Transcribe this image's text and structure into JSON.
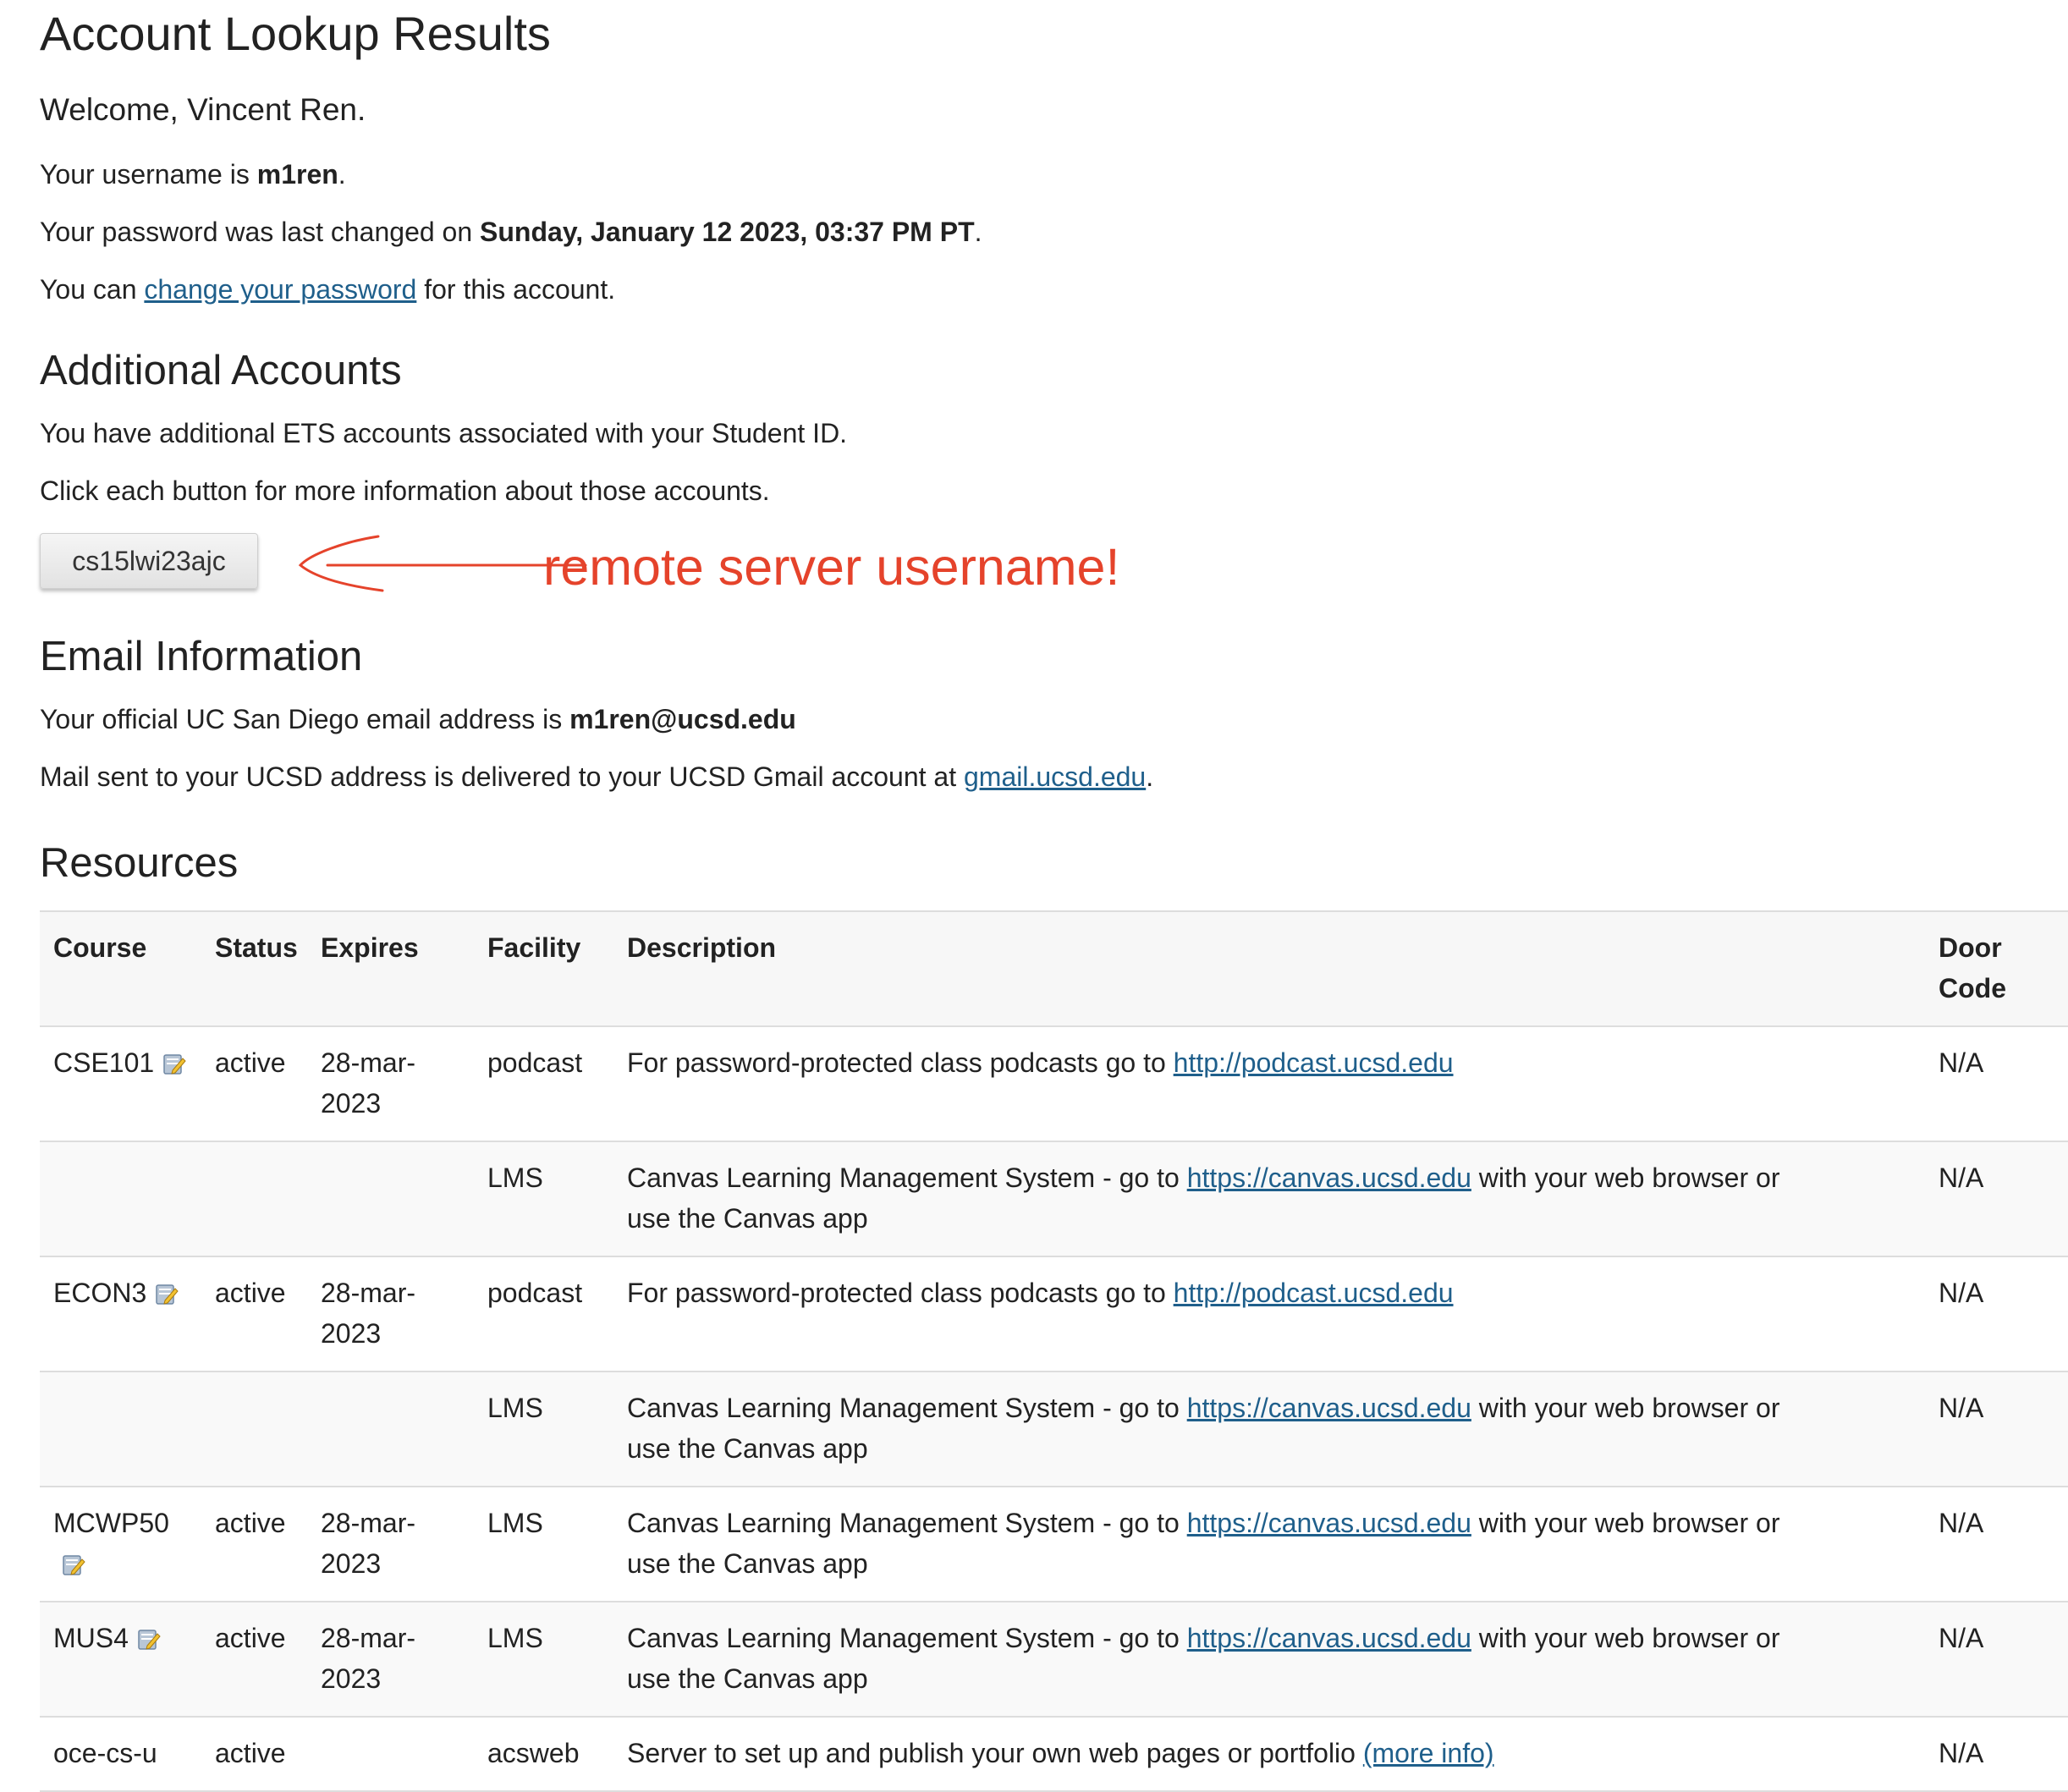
{
  "header": {
    "title": "Account Lookup Results"
  },
  "welcome": "Welcome, Vincent Ren.",
  "username_line": {
    "prefix": "Your username is ",
    "value": "m1ren",
    "suffix": "."
  },
  "password_line": {
    "prefix": "Your password was last changed on ",
    "value": "Sunday, January 12 2023, 03:37 PM PT",
    "suffix": "."
  },
  "change_line": {
    "prefix": "You can ",
    "link": "change your password",
    "suffix": " for this account."
  },
  "additional": {
    "title": "Additional Accounts",
    "line1": "You have additional ETS accounts associated with your Student ID.",
    "line2": "Click each button for more information about those accounts.",
    "button_label": "cs15lwi23ajc",
    "annotation": "remote server username!"
  },
  "email": {
    "title": "Email Information",
    "line1_prefix": "Your official UC San Diego email address is ",
    "line1_value": "m1ren@ucsd.edu",
    "line2_prefix": "Mail sent to your UCSD address is delivered to your UCSD Gmail account at ",
    "line2_link": "gmail.ucsd.edu",
    "line2_suffix": "."
  },
  "resources": {
    "title": "Resources",
    "headers": {
      "course": "Course",
      "status": "Status",
      "expires": "Expires",
      "facility": "Facility",
      "description": "Description",
      "door_line1": "Door",
      "door_line2": "Code"
    },
    "podcast_text": "For password-protected class podcasts go to ",
    "podcast_link": "http://podcast.ucsd.edu",
    "lms_text": "Canvas Learning Management System - go to ",
    "lms_link": "https://canvas.ucsd.edu",
    "lms_suffix": " with your web browser or use the Canvas app",
    "acsweb_text": "Server to set up and publish your own web pages or portfolio ",
    "acsweb_link": "(more info)",
    "rows": [
      {
        "course": "CSE101",
        "status": "active",
        "expires_a": "28-mar-",
        "expires_b": "2023",
        "facility": "podcast",
        "door": "N/A"
      },
      {
        "course": "",
        "status": "",
        "expires_a": "",
        "expires_b": "",
        "facility": "LMS",
        "door": "N/A"
      },
      {
        "course": "ECON3",
        "status": "active",
        "expires_a": "28-mar-",
        "expires_b": "2023",
        "facility": "podcast",
        "door": "N/A"
      },
      {
        "course": "",
        "status": "",
        "expires_a": "",
        "expires_b": "",
        "facility": "LMS",
        "door": "N/A"
      },
      {
        "course": "MCWP50",
        "status": "active",
        "expires_a": "28-mar-",
        "expires_b": "2023",
        "facility": "LMS",
        "door": "N/A"
      },
      {
        "course": "MUS4",
        "status": "active",
        "expires_a": "28-mar-",
        "expires_b": "2023",
        "facility": "LMS",
        "door": "N/A"
      },
      {
        "course": "oce-cs-u",
        "status": "active",
        "expires_a": "",
        "expires_b": "",
        "facility": "acsweb",
        "door": "N/A"
      }
    ]
  },
  "colors": {
    "link": "#1f5f8b",
    "annotation": "#e5432b",
    "border": "#dddddd"
  }
}
